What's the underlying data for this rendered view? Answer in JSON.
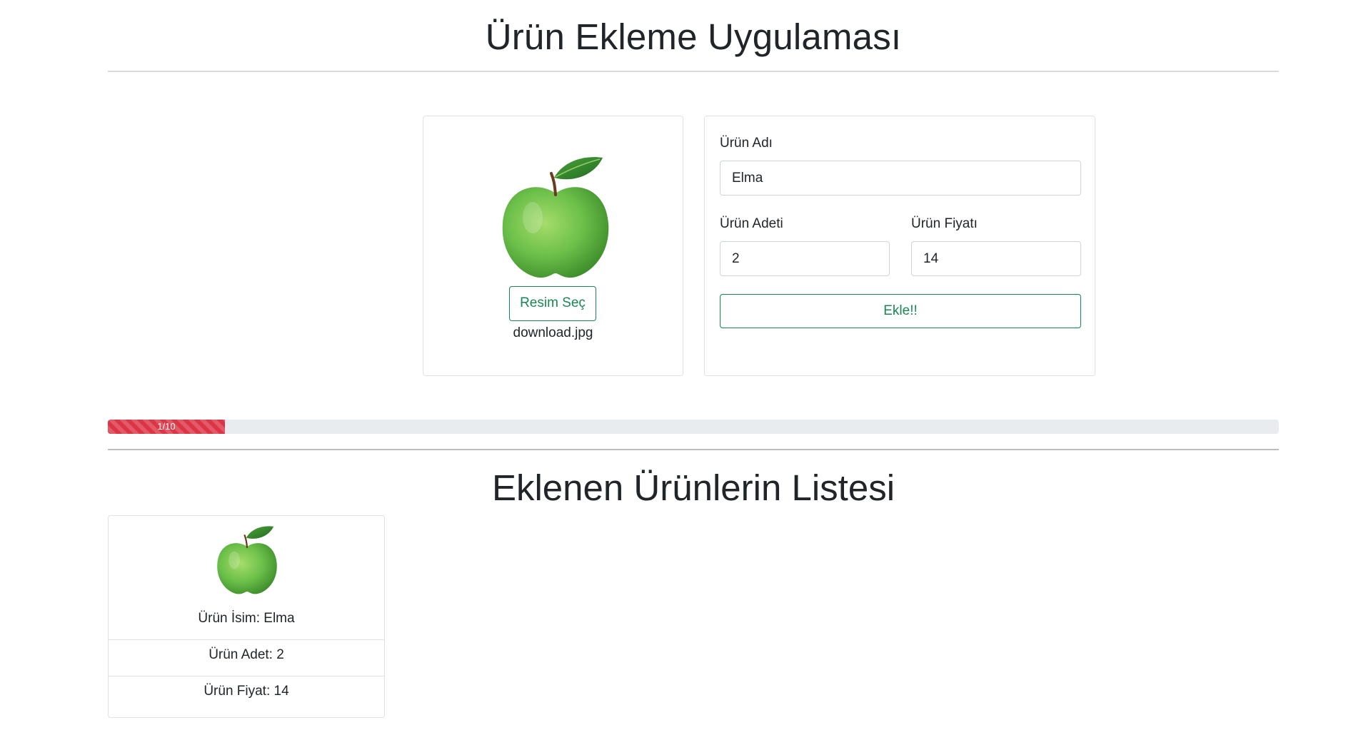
{
  "header": {
    "title": "Ürün Ekleme Uygulaması"
  },
  "image_card": {
    "select_button_label": "Resim Seç",
    "file_name": "download.jpg"
  },
  "form": {
    "name_label": "Ürün Adı",
    "name_value": "Elma",
    "quantity_label": "Ürün Adeti",
    "quantity_value": "2",
    "price_label": "Ürün Fiyatı",
    "price_value": "14",
    "add_button_label": "Ekle!!"
  },
  "progress": {
    "label": "1/10",
    "value": 1,
    "max": 10,
    "color": "#dc3545"
  },
  "list": {
    "title": "Eklenen Ürünlerin Listesi",
    "items": [
      {
        "name_text": "Ürün İsim: Elma",
        "quantity_text": "Ürün Adet: 2",
        "price_text": "Ürün Fiyat: 14"
      }
    ]
  },
  "colors": {
    "accent": "#198754",
    "progress": "#dc3545",
    "apple_green": "#6cc04a"
  }
}
